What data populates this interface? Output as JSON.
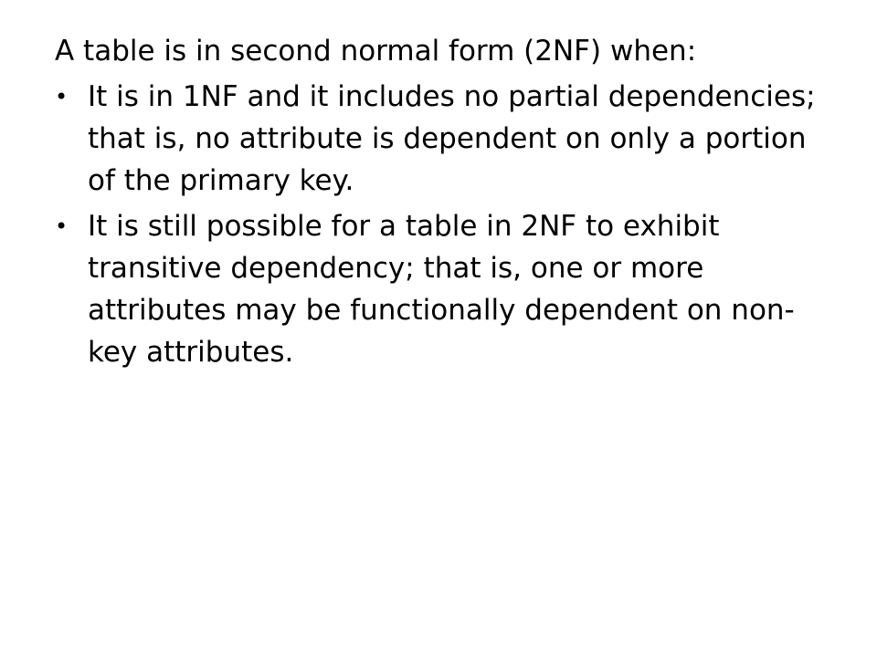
{
  "slide": {
    "intro": "A table is in second normal form (2NF) when:",
    "bullets": [
      {
        "marker": "•",
        "text": "It is in 1NF and it includes no partial dependencies; that is, no attribute is dependent on only a portion of the primary key."
      },
      {
        "marker": "•",
        "text": "It is still possible for a table in 2NF to exhibit transitive dependency; that is, one or more attributes may be functionally dependent on non-key attributes."
      }
    ]
  },
  "colors": {
    "background": "#ffffff",
    "text": "#000000"
  }
}
